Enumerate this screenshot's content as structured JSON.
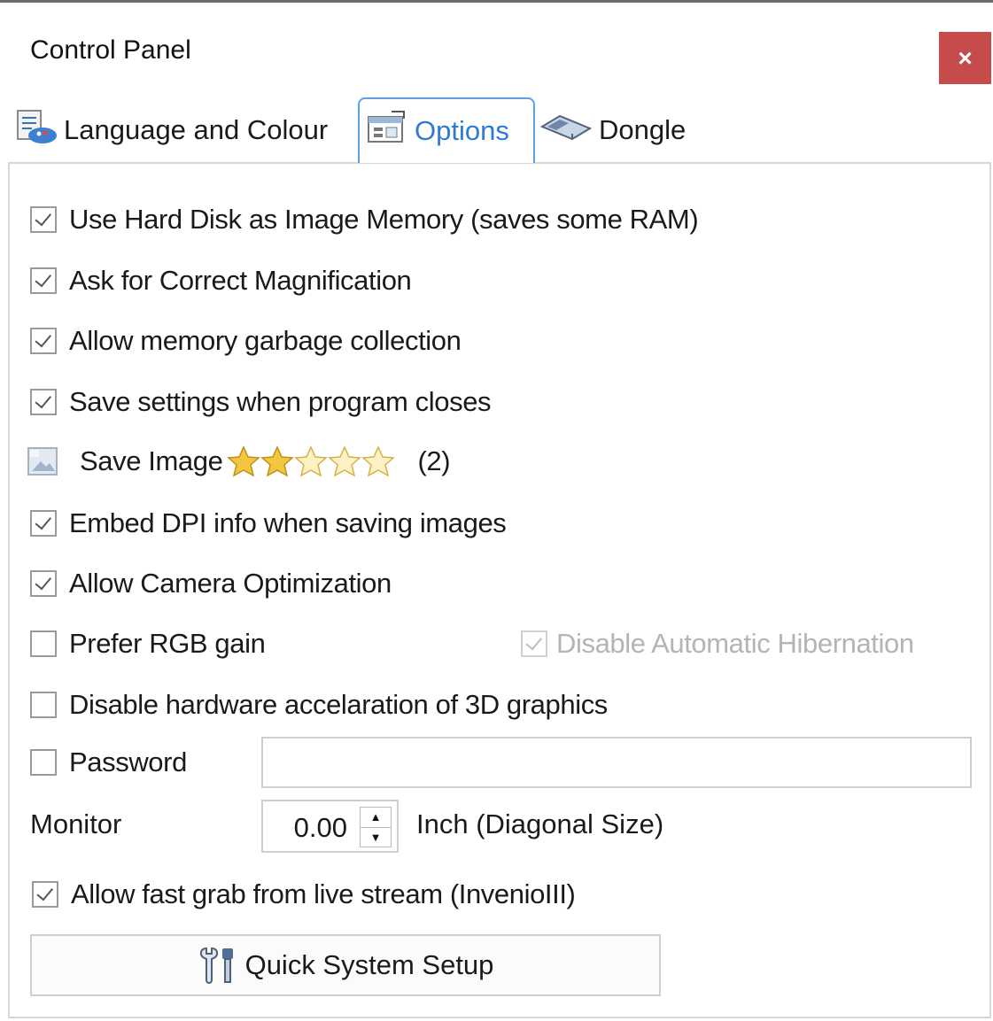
{
  "window": {
    "title": "Control Panel",
    "close_label": "×"
  },
  "tabs": [
    {
      "label": "Language and Colour",
      "icon": "document-paint-icon"
    },
    {
      "label": "Options",
      "icon": "options-icon",
      "active": true
    },
    {
      "label": "Dongle",
      "icon": "dongle-icon"
    }
  ],
  "options": {
    "use_hard_disk": {
      "label": "Use Hard Disk as Image Memory (saves some RAM)",
      "checked": true
    },
    "ask_magnification": {
      "label": "Ask for Correct Magnification",
      "checked": true
    },
    "allow_gc": {
      "label": "Allow memory garbage collection",
      "checked": true
    },
    "save_settings": {
      "label": "Save settings when program closes",
      "checked": true
    },
    "save_image": {
      "label": "Save Image",
      "rating_text": "(2)",
      "rating": 2,
      "rating_max": 5
    },
    "embed_dpi": {
      "label": "Embed DPI info when saving images",
      "checked": true
    },
    "camera_opt": {
      "label": "Allow Camera Optimization",
      "checked": true
    },
    "prefer_rgb": {
      "label": "Prefer RGB gain",
      "checked": false
    },
    "disable_hibernation": {
      "label": "Disable Automatic Hibernation",
      "checked": true,
      "enabled": false
    },
    "disable_hw_accel": {
      "label": "Disable hardware accelaration of 3D graphics",
      "checked": false
    },
    "password": {
      "label": "Password",
      "checked": false,
      "value": ""
    },
    "monitor": {
      "label": "Monitor",
      "value": "0.00",
      "unit_label": "Inch (Diagonal Size)"
    },
    "fast_grab": {
      "label": "Allow fast grab from live stream (InvenioIII)",
      "checked": true
    }
  },
  "quick_setup": {
    "label": "Quick System Setup",
    "icon": "tools-icon"
  },
  "colors": {
    "close_bg": "#c64b4b",
    "active_tab": "#2e7ad6",
    "star": "#f3c640"
  }
}
